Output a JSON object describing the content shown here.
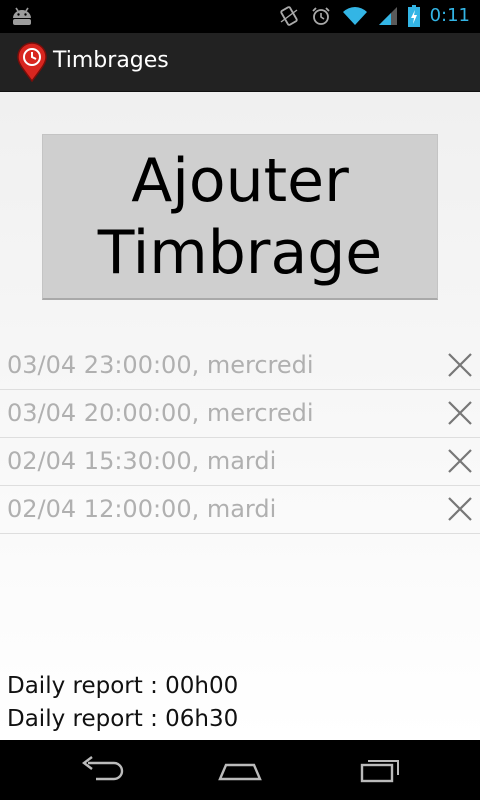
{
  "status_bar": {
    "time": "0:11",
    "battery_level": 0.7,
    "colors": {
      "accent": "#33b5e5"
    }
  },
  "action_bar": {
    "title": "Timbrages"
  },
  "main": {
    "add_button_label": "Ajouter\nTimbrage",
    "entries": [
      {
        "text": "03/04 23:00:00, mercredi"
      },
      {
        "text": "03/04 20:00:00, mercredi"
      },
      {
        "text": "02/04 15:30:00, mardi"
      },
      {
        "text": "02/04 12:00:00, mardi"
      }
    ],
    "reports": [
      {
        "text": "Daily report : 00h00"
      },
      {
        "text": "Daily report : 06h30"
      }
    ]
  }
}
